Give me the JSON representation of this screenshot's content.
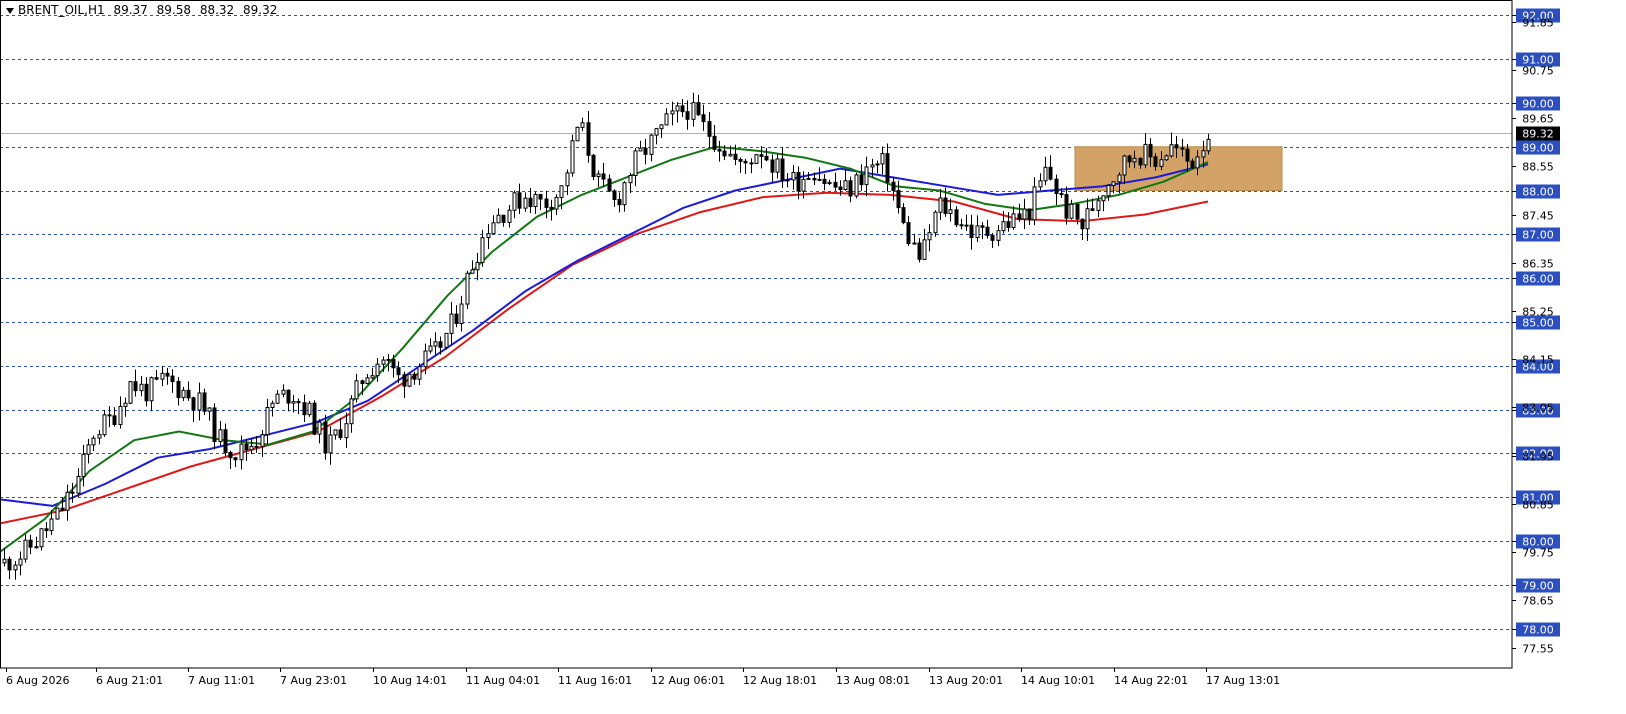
{
  "header": {
    "symbol": "BRENT_OIL,H1",
    "open": "89.37",
    "high": "89.58",
    "low": "88.32",
    "close": "89.32"
  },
  "colors": {
    "grid": "#2b4fbf",
    "ma_fast": "#117711",
    "ma_mid": "#1a1adb",
    "ma_slow": "#e01818",
    "zone": "#d2a266",
    "current_price_bg": "#000000"
  },
  "chart_data": {
    "type": "candlestick",
    "timeframe": "H1",
    "ylim": [
      77.1,
      92.35
    ],
    "current_price": "89.32",
    "price_grid_levels": [
      "78.00",
      "79.00",
      "80.00",
      "81.00",
      "82.00",
      "83.00",
      "84.00",
      "85.00",
      "86.00",
      "87.00",
      "88.00",
      "89.00",
      "90.00",
      "91.00",
      "92.00"
    ],
    "intermediate_ticks": [
      "91.85",
      "90.75",
      "89.65",
      "88.55",
      "87.45",
      "86.35",
      "85.25",
      "84.15",
      "83.05",
      "81.95",
      "80.85",
      "79.75",
      "78.65",
      "77.55"
    ],
    "x_labels": [
      "6 Aug 2026",
      "6 Aug 21:01",
      "7 Aug 11:01",
      "7 Aug 23:01",
      "10 Aug 14:01",
      "11 Aug 04:01",
      "11 Aug 16:01",
      "12 Aug 06:01",
      "12 Aug 18:01",
      "13 Aug 08:01",
      "13 Aug 20:01",
      "14 Aug 10:01",
      "14 Aug 22:01",
      "17 Aug 13:01"
    ],
    "close_path": [
      79.5,
      79.7,
      80.1,
      80.6,
      81.3,
      82.5,
      82.8,
      83.6,
      83.4,
      83.7,
      83.4,
      83.1,
      82.3,
      82.0,
      82.3,
      83.2,
      83.4,
      82.9,
      82.1,
      82.8,
      83.8,
      84.2,
      83.7,
      84.0,
      84.3,
      85.0,
      86.3,
      87.3,
      87.6,
      87.9,
      87.7,
      88.0,
      89.6,
      88.2,
      87.7,
      88.6,
      89.1,
      89.6,
      89.9,
      89.4,
      89.0,
      88.5,
      89.0,
      88.5,
      88.2,
      88.5,
      88.1,
      88.0,
      88.5,
      88.6,
      87.2,
      86.4,
      87.7,
      87.4,
      87.0,
      87.1,
      87.3,
      87.5,
      88.5,
      87.6,
      87.2,
      88.0,
      88.5,
      88.9,
      88.7,
      89.0,
      88.6,
      89.32
    ],
    "ma_fast": [
      79.75,
      80.5,
      81.6,
      82.3,
      82.5,
      82.3,
      82.2,
      82.5,
      83.3,
      84.4,
      85.6,
      86.6,
      87.4,
      87.9,
      88.3,
      88.7,
      89.0,
      88.9,
      88.75,
      88.5,
      88.1,
      88.0,
      87.7,
      87.55,
      87.7,
      87.9,
      88.2,
      88.65
    ],
    "ma_mid": [
      80.95,
      80.8,
      81.3,
      81.9,
      82.1,
      82.4,
      82.7,
      83.2,
      84.0,
      84.8,
      85.7,
      86.4,
      87.0,
      87.6,
      88.0,
      88.25,
      88.5,
      88.3,
      88.1,
      87.9,
      88.0,
      88.1,
      88.3,
      88.6
    ],
    "ma_slow": [
      80.4,
      80.7,
      81.2,
      81.7,
      82.1,
      82.5,
      83.3,
      84.2,
      85.3,
      86.3,
      87.0,
      87.5,
      87.85,
      87.95,
      87.9,
      87.75,
      87.35,
      87.3,
      87.45,
      87.75
    ],
    "zone": {
      "from": 88.0,
      "to": 89.0
    }
  }
}
